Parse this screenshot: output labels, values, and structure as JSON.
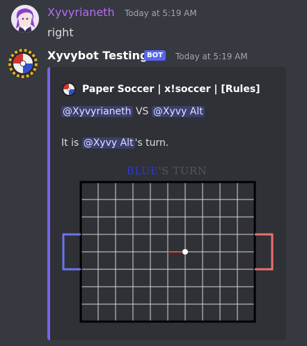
{
  "messages": [
    {
      "username": "Xyvyrianeth",
      "timestamp": "Today at 5:19 AM",
      "text": "right",
      "username_color": "#b46cf3"
    },
    {
      "username": "Xyvybot Testing",
      "bot_tag": "BOT",
      "timestamp": "Today at 5:19 AM",
      "username_color": "#ffffff"
    }
  ],
  "embed": {
    "accent_color": "#7366ec",
    "author": "Paper Soccer | x!soccer | [Rules]",
    "line1": {
      "mention_a": "@Xyvyrianeth",
      "vs": " VS ",
      "mention_b": "@Xyvy Alt"
    },
    "line2": {
      "prefix": "It is ",
      "mention": "@Xyvy Alt",
      "suffix": "'s turn."
    },
    "turn_title": {
      "blue_part": "BLUE",
      "rest": "'S TURN"
    }
  },
  "board": {
    "blue_goal_color": "#6a73f0",
    "red_goal_color": "#f06e6e",
    "move_color": "#e24545",
    "grid_color": "#d8d8d8",
    "border_color": "#000000",
    "cols": 10,
    "rows": 8,
    "ball": {
      "col": 6,
      "row": 4
    },
    "last_move_from": {
      "col": 5,
      "row": 4
    }
  }
}
